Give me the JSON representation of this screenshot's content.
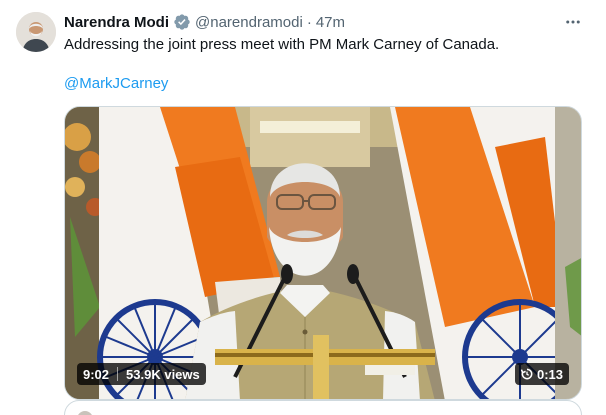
{
  "tweet": {
    "author_name": "Narendra Modi",
    "handle": "@narendramodi",
    "separator": "·",
    "time": "47m",
    "text": "Addressing the joint press meet with PM Mark Carney of Canada.",
    "mention": "@MarkJCarney",
    "icons": {
      "verified": "verified-badge-icon",
      "more": "more-options-icon",
      "replay": "replay-icon"
    }
  },
  "media": {
    "type": "video",
    "duration": "9:02",
    "views": "53.9K views",
    "remaining": "0:13"
  },
  "colors": {
    "link": "#1d9bf0",
    "verified": "#829aab",
    "secondary_text": "#536471",
    "border": "#cfd9de"
  }
}
